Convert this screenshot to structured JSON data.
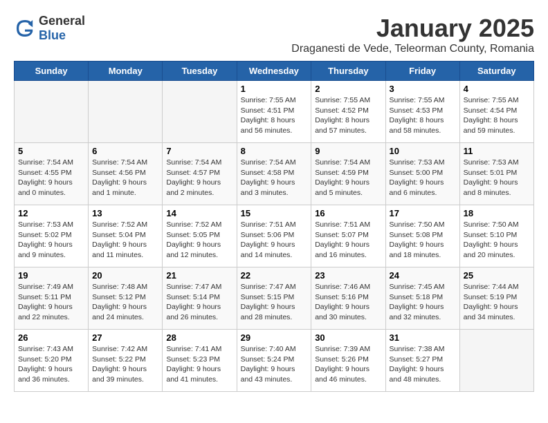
{
  "header": {
    "logo_general": "General",
    "logo_blue": "Blue",
    "month": "January 2025",
    "location": "Draganesti de Vede, Teleorman County, Romania"
  },
  "days_of_week": [
    "Sunday",
    "Monday",
    "Tuesday",
    "Wednesday",
    "Thursday",
    "Friday",
    "Saturday"
  ],
  "weeks": [
    [
      {
        "day": "",
        "info": ""
      },
      {
        "day": "",
        "info": ""
      },
      {
        "day": "",
        "info": ""
      },
      {
        "day": "1",
        "info": "Sunrise: 7:55 AM\nSunset: 4:51 PM\nDaylight: 8 hours and 56 minutes."
      },
      {
        "day": "2",
        "info": "Sunrise: 7:55 AM\nSunset: 4:52 PM\nDaylight: 8 hours and 57 minutes."
      },
      {
        "day": "3",
        "info": "Sunrise: 7:55 AM\nSunset: 4:53 PM\nDaylight: 8 hours and 58 minutes."
      },
      {
        "day": "4",
        "info": "Sunrise: 7:55 AM\nSunset: 4:54 PM\nDaylight: 8 hours and 59 minutes."
      }
    ],
    [
      {
        "day": "5",
        "info": "Sunrise: 7:54 AM\nSunset: 4:55 PM\nDaylight: 9 hours and 0 minutes."
      },
      {
        "day": "6",
        "info": "Sunrise: 7:54 AM\nSunset: 4:56 PM\nDaylight: 9 hours and 1 minute."
      },
      {
        "day": "7",
        "info": "Sunrise: 7:54 AM\nSunset: 4:57 PM\nDaylight: 9 hours and 2 minutes."
      },
      {
        "day": "8",
        "info": "Sunrise: 7:54 AM\nSunset: 4:58 PM\nDaylight: 9 hours and 3 minutes."
      },
      {
        "day": "9",
        "info": "Sunrise: 7:54 AM\nSunset: 4:59 PM\nDaylight: 9 hours and 5 minutes."
      },
      {
        "day": "10",
        "info": "Sunrise: 7:53 AM\nSunset: 5:00 PM\nDaylight: 9 hours and 6 minutes."
      },
      {
        "day": "11",
        "info": "Sunrise: 7:53 AM\nSunset: 5:01 PM\nDaylight: 9 hours and 8 minutes."
      }
    ],
    [
      {
        "day": "12",
        "info": "Sunrise: 7:53 AM\nSunset: 5:02 PM\nDaylight: 9 hours and 9 minutes."
      },
      {
        "day": "13",
        "info": "Sunrise: 7:52 AM\nSunset: 5:04 PM\nDaylight: 9 hours and 11 minutes."
      },
      {
        "day": "14",
        "info": "Sunrise: 7:52 AM\nSunset: 5:05 PM\nDaylight: 9 hours and 12 minutes."
      },
      {
        "day": "15",
        "info": "Sunrise: 7:51 AM\nSunset: 5:06 PM\nDaylight: 9 hours and 14 minutes."
      },
      {
        "day": "16",
        "info": "Sunrise: 7:51 AM\nSunset: 5:07 PM\nDaylight: 9 hours and 16 minutes."
      },
      {
        "day": "17",
        "info": "Sunrise: 7:50 AM\nSunset: 5:08 PM\nDaylight: 9 hours and 18 minutes."
      },
      {
        "day": "18",
        "info": "Sunrise: 7:50 AM\nSunset: 5:10 PM\nDaylight: 9 hours and 20 minutes."
      }
    ],
    [
      {
        "day": "19",
        "info": "Sunrise: 7:49 AM\nSunset: 5:11 PM\nDaylight: 9 hours and 22 minutes."
      },
      {
        "day": "20",
        "info": "Sunrise: 7:48 AM\nSunset: 5:12 PM\nDaylight: 9 hours and 24 minutes."
      },
      {
        "day": "21",
        "info": "Sunrise: 7:47 AM\nSunset: 5:14 PM\nDaylight: 9 hours and 26 minutes."
      },
      {
        "day": "22",
        "info": "Sunrise: 7:47 AM\nSunset: 5:15 PM\nDaylight: 9 hours and 28 minutes."
      },
      {
        "day": "23",
        "info": "Sunrise: 7:46 AM\nSunset: 5:16 PM\nDaylight: 9 hours and 30 minutes."
      },
      {
        "day": "24",
        "info": "Sunrise: 7:45 AM\nSunset: 5:18 PM\nDaylight: 9 hours and 32 minutes."
      },
      {
        "day": "25",
        "info": "Sunrise: 7:44 AM\nSunset: 5:19 PM\nDaylight: 9 hours and 34 minutes."
      }
    ],
    [
      {
        "day": "26",
        "info": "Sunrise: 7:43 AM\nSunset: 5:20 PM\nDaylight: 9 hours and 36 minutes."
      },
      {
        "day": "27",
        "info": "Sunrise: 7:42 AM\nSunset: 5:22 PM\nDaylight: 9 hours and 39 minutes."
      },
      {
        "day": "28",
        "info": "Sunrise: 7:41 AM\nSunset: 5:23 PM\nDaylight: 9 hours and 41 minutes."
      },
      {
        "day": "29",
        "info": "Sunrise: 7:40 AM\nSunset: 5:24 PM\nDaylight: 9 hours and 43 minutes."
      },
      {
        "day": "30",
        "info": "Sunrise: 7:39 AM\nSunset: 5:26 PM\nDaylight: 9 hours and 46 minutes."
      },
      {
        "day": "31",
        "info": "Sunrise: 7:38 AM\nSunset: 5:27 PM\nDaylight: 9 hours and 48 minutes."
      },
      {
        "day": "",
        "info": ""
      }
    ]
  ]
}
